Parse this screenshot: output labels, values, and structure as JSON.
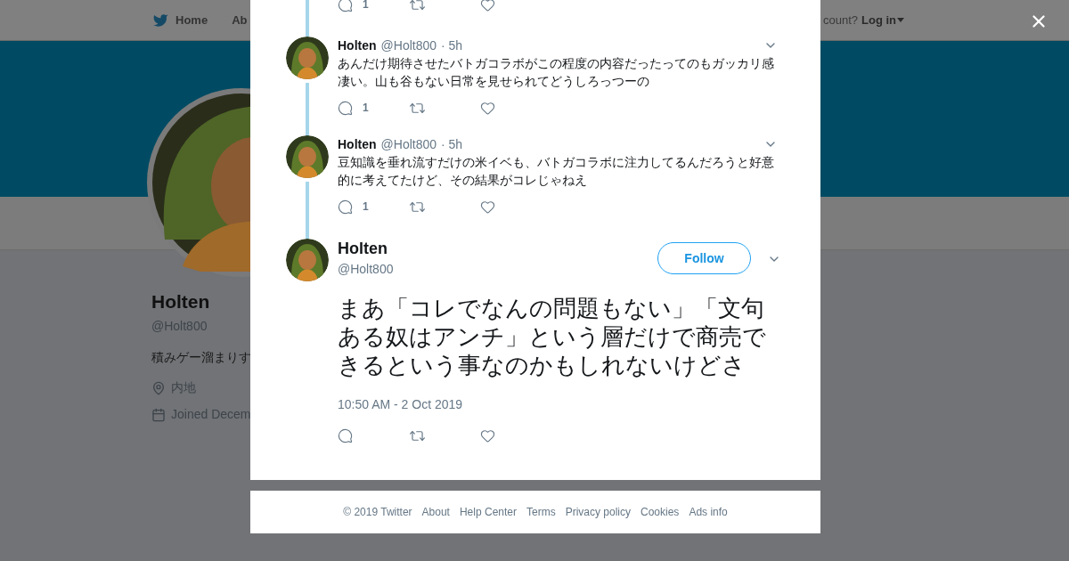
{
  "nav": {
    "items": [
      {
        "label": "Home",
        "kind": "bird"
      },
      {
        "label": "Ab",
        "kind": "plain"
      }
    ],
    "account_prompt": "count?",
    "login": "Log in"
  },
  "profile": {
    "name": "Holten",
    "handle": "@Holt800",
    "bio": "積みゲー溜まりす",
    "location": "内地",
    "joined": "Joined Decem"
  },
  "modal": {
    "top_actions": {
      "reply_count": "1"
    },
    "thread": [
      {
        "name": "Holten",
        "handle": "@Holt800",
        "time": "· 5h",
        "text": "あんだけ期待させたバトガコラボがこの程度の内容だったってのもガッカリ感凄い。山も谷もない日常を見せられてどうしろっつーの",
        "reply_count": "1"
      },
      {
        "name": "Holten",
        "handle": "@Holt800",
        "time": "· 5h",
        "text": "豆知識を垂れ流すだけの米イベも、バトガコラボに注力してるんだろうと好意的に考えてたけど、その結果がコレじゃねえ",
        "reply_count": "1"
      }
    ],
    "main_tweet": {
      "name": "Holten",
      "handle": "@Holt800",
      "follow": "Follow",
      "text": "まあ「コレでなんの問題もない」「文句ある奴はアンチ」という層だけで商売できるという事なのかもしれないけどさ",
      "timestamp": "10:50 AM - 2 Oct 2019"
    }
  },
  "footer": {
    "links": [
      "© 2019 Twitter",
      "About",
      "Help Center",
      "Terms",
      "Privacy policy",
      "Cookies",
      "Ads info"
    ]
  }
}
